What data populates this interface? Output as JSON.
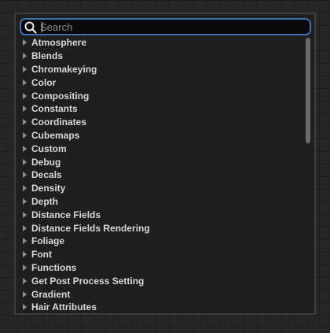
{
  "search": {
    "placeholder": "Search",
    "value": ""
  },
  "categories": [
    {
      "label": "Atmosphere"
    },
    {
      "label": "Blends"
    },
    {
      "label": "Chromakeying"
    },
    {
      "label": "Color"
    },
    {
      "label": "Compositing"
    },
    {
      "label": "Constants"
    },
    {
      "label": "Coordinates"
    },
    {
      "label": "Cubemaps"
    },
    {
      "label": "Custom"
    },
    {
      "label": "Debug"
    },
    {
      "label": "Decals"
    },
    {
      "label": "Density"
    },
    {
      "label": "Depth"
    },
    {
      "label": "Distance Fields"
    },
    {
      "label": "Distance Fields Rendering"
    },
    {
      "label": "Foliage"
    },
    {
      "label": "Font"
    },
    {
      "label": "Functions"
    },
    {
      "label": "Get Post Process Setting"
    },
    {
      "label": "Gradient"
    },
    {
      "label": "Hair Attributes"
    }
  ],
  "icons": {
    "search": "search-icon",
    "expand": "chevron-right-icon"
  },
  "colors": {
    "focus_border": "#3a6fb0",
    "panel_background": "#1f1f1f",
    "text": "#d7d7d7"
  }
}
